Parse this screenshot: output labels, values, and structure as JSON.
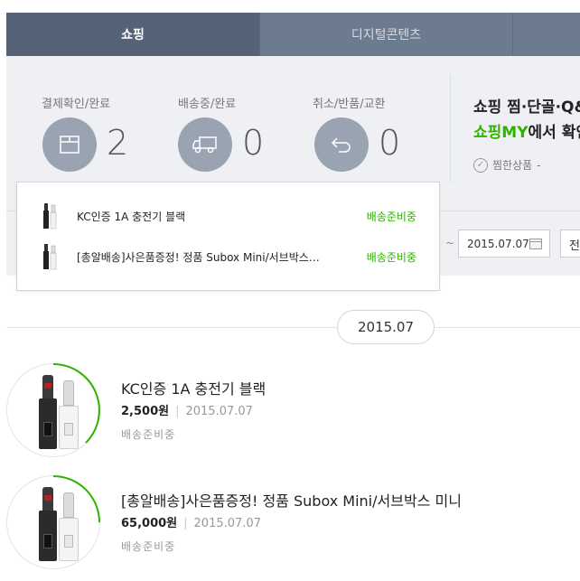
{
  "tabs": [
    {
      "label": "쇼핑",
      "active": true
    },
    {
      "label": "디지털콘텐츠",
      "active": false
    },
    {
      "label": "",
      "active": false
    }
  ],
  "summary": {
    "stats": [
      {
        "label": "결제확인/완료",
        "count": "2",
        "icon": "box-icon"
      },
      {
        "label": "배송중/완료",
        "count": "0",
        "icon": "truck-icon"
      },
      {
        "label": "취소/반품/교환",
        "count": "0",
        "icon": "return-arrow-icon"
      }
    ],
    "promo": {
      "line1": "쇼핑 찜·단골·Q&",
      "line2_green": "쇼핑MY",
      "line2_rest": "에서 확인",
      "line3": "찜한상품",
      "line3_dash": "-"
    }
  },
  "filter": {
    "tilde": "~",
    "end_date": "2015.07.07",
    "extra": "전"
  },
  "popup": {
    "items": [
      {
        "name": "KC인증 1A 충전기 블랙",
        "status": "배송준비중"
      },
      {
        "name": "[총알배송]사은품증정! 정품 Subox Mini/서브박스…",
        "status": "배송준비중"
      }
    ]
  },
  "month_label": "2015.07",
  "orders": [
    {
      "title": "KC인증 1A 충전기 블랙",
      "price": "2,500원",
      "date": "2015.07.07",
      "status": "배송준비중"
    },
    {
      "title": "[총알배송]사은품증정! 정품 Subox Mini/서브박스 미니",
      "price": "65,000원",
      "date": "2015.07.07",
      "status": "배송준비중"
    }
  ],
  "colors": {
    "accent_green": "#2db400",
    "tab_active": "#556277",
    "tab_bar": "#6d7b90",
    "stat_circle": "#9aa3b2"
  }
}
